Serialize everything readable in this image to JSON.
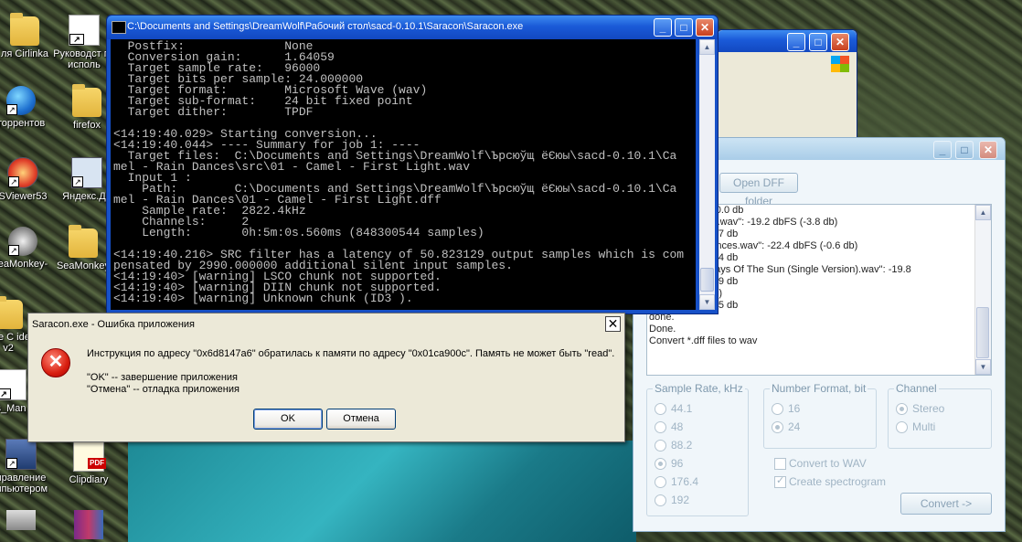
{
  "desktop": {
    "icons": [
      {
        "label": "ля Cirlinka",
        "icon": "folder-icon"
      },
      {
        "label": "Руководст по исполь",
        "icon": "pdf-document-icon"
      },
      {
        "label": "торрентов",
        "icon": "globe-icon"
      },
      {
        "label": "firefox",
        "icon": "folder-icon"
      },
      {
        "label": "SViewer53",
        "icon": "app-icon"
      },
      {
        "label": "Яндекс.Ди",
        "icon": "app-window-icon"
      },
      {
        "label": "eaMonkey-",
        "icon": "seamonkey-icon"
      },
      {
        "label": "SeaMonkey",
        "icon": "folder-icon"
      },
      {
        "label": "ture C ide v2",
        "icon": "folder-icon"
      },
      {
        "label": "s_Man",
        "icon": "pdf-document-icon"
      },
      {
        "label": "правление мпьютером",
        "icon": "computer-icon"
      },
      {
        "label": "Clipdiary",
        "icon": "document-icon"
      },
      {
        "label": "",
        "icon": "drive-icon"
      },
      {
        "label": "",
        "icon": "archive-icon"
      }
    ]
  },
  "console": {
    "title": "C:\\Documents and Settings\\DreamWolf\\Рабочий стол\\sacd-0.10.1\\Saracon\\Saracon.exe",
    "lines": [
      "  Postfix:              None",
      "  Conversion gain:      1.64059",
      "  Target sample rate:   96000",
      "  Target bits per sample: 24.000000",
      "  Target format:        Microsoft Wave (wav)",
      "  Target sub-format:    24 bit fixed point",
      "  Target dither:        TPDF",
      "",
      "<14:19:40.029> Starting conversion...",
      "<14:19:40.044> ---- Summary for job 1: ----",
      "  Target files:  C:\\Documents and Settings\\DreamWolf\\Ърсюўщ ёЄюы\\sacd-0.10.1\\Ca",
      "mel - Rain Dances\\src\\01 - Camel - First Light.wav",
      "  Input 1 :",
      "    Path:        C:\\Documents and Settings\\DreamWolf\\Ърсюўщ ёЄюы\\sacd-0.10.1\\Ca",
      "mel - Rain Dances\\01 - Camel - First Light.dff",
      "    Sample rate:  2822.4kHz",
      "    Channels:     2",
      "    Length:       0h:5m:0s.560ms (848300544 samples)",
      "",
      "<14:19:40.216> SRC filter has a latency of 50.823129 output samples which is com",
      "pensated by 2990.000000 additional silent input samples.",
      "<14:19:40> [warning] LSCO chunk not supported.",
      "<14:19:40> [warning] DIIN chunk not supported.",
      "<14:19:40> [warning] Unknown chunk (ID3 )."
    ]
  },
  "gui": {
    "open_dff_label": "Open DFF folder",
    "log_lines": [
      "dbFS, range: 10.0 db",
      "amel - Skylines.wav\": -19.2 dbFS (-3.8 db)",
      "dbFS, range: 3.7 db",
      "amel - Rain Dances.wav\": -22.4 dbFS (-0.6 db)",
      "dbFS, range: 8.4 db",
      "Camel - Highways Of The Sun (Single Version).wav\": -19.8",
      "",
      "dbFS, range: 4.9 db",
      "8 dbFS (-3.2 db)",
      "dbFS, range: 9.5 db",
      " done.",
      "Done.",
      "Convert *.dff files to wav"
    ],
    "sample_rate_label": "Sample Rate, kHz",
    "sample_rates": [
      "44.1",
      "48",
      "88.2",
      "96",
      "176.4",
      "192"
    ],
    "sample_rate_selected": "96",
    "number_format_label": "Number Format, bit",
    "number_formats": [
      "16",
      "24"
    ],
    "number_format_selected": "24",
    "channel_label": "Channel",
    "channels": [
      "Stereo",
      "Multi"
    ],
    "channel_selected": "Stereo",
    "convert_to_wav_label": "Convert to WAV",
    "convert_to_wav_checked": false,
    "create_spectrogram_label": "Create spectrogram",
    "create_spectrogram_checked": true,
    "convert_button_label": "Convert ->"
  },
  "dialog": {
    "title": "Saracon.exe - Ошибка приложения",
    "message": "Инструкция по адресу \"0x6d8147a6\" обратилась к памяти по адресу \"0x01ca900c\". Память не может быть \"read\".",
    "ok_hint": "\"OK\" -- завершение приложения",
    "cancel_hint": "\"Отмена\" -- отладка приложения",
    "ok_label": "OK",
    "cancel_label": "Отмена"
  },
  "colors": {
    "xp_title_blue": "#1a5ad8",
    "console_bg": "#000000",
    "console_text": "#c0c0c0",
    "error_red": "#d81f10"
  }
}
